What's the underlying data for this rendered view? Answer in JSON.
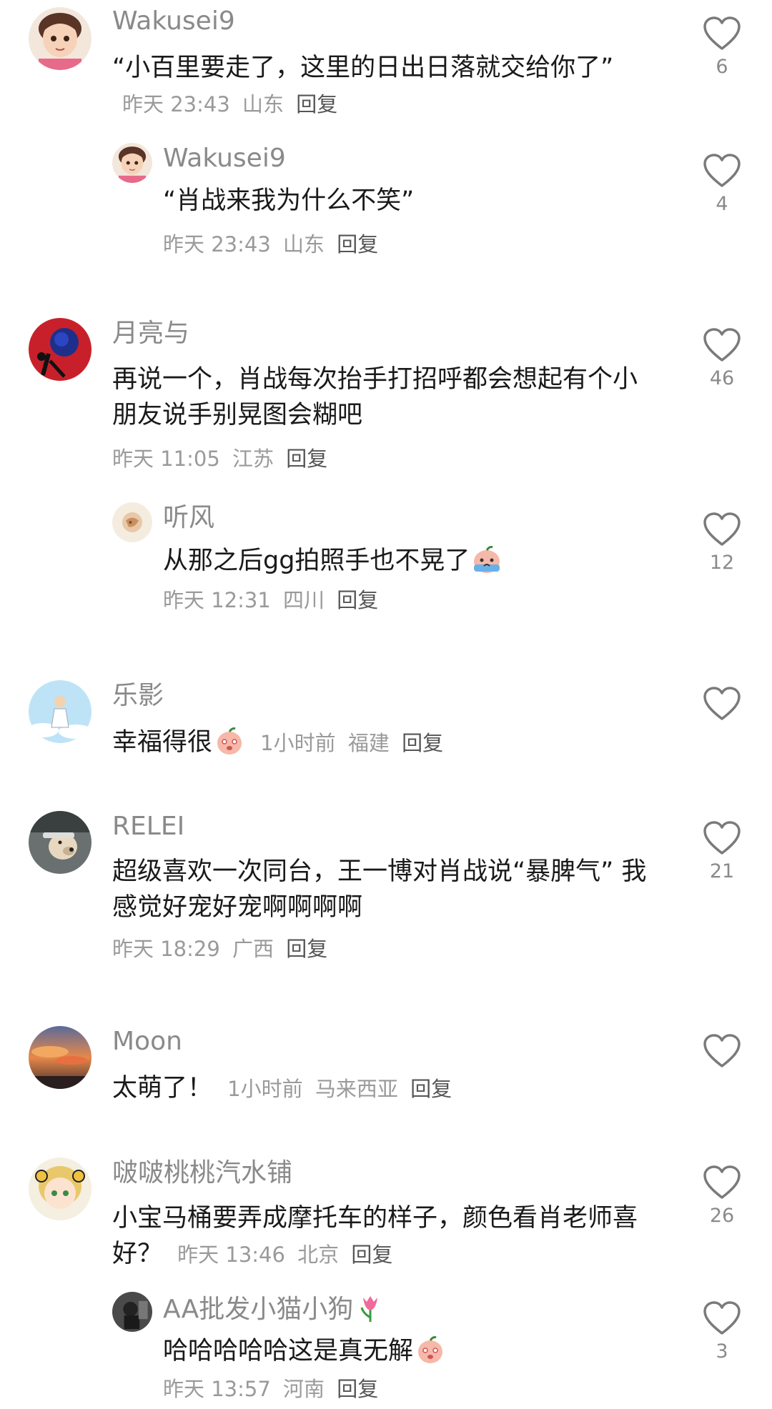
{
  "comments": [
    {
      "user": "Wakusei9",
      "text": "“小百里要走了，这里的日出日落就交给你了”",
      "time": "昨天 23:43",
      "location": "山东",
      "reply": "回复",
      "likes": "6",
      "avatar_icon": "cartoon-man-avatar",
      "replies": [
        {
          "user": "Wakusei9",
          "text": "“肖战来我为什么不笑”",
          "time": "昨天 23:43",
          "location": "山东",
          "reply": "回复",
          "likes": "4",
          "avatar_icon": "cartoon-man-avatar"
        }
      ]
    },
    {
      "user": "月亮与",
      "text": "再说一个，肖战每次抬手打招呼都会想起有个小朋友说手别晃图会糊吧",
      "time": "昨天 11:05",
      "location": "江苏",
      "reply": "回复",
      "likes": "46",
      "avatar_icon": "blue-rose-avatar",
      "replies": [
        {
          "user": "听风",
          "text": "从那之后gg拍照手也不晃了",
          "emoji": "crying-peach-emoji",
          "time": "昨天 12:31",
          "location": "四川",
          "reply": "回复",
          "likes": "12",
          "avatar_icon": "illustration-avatar"
        }
      ]
    },
    {
      "user": "乐影",
      "text": "幸福得很",
      "emoji": "peach-emoji",
      "time": "1小时前",
      "location": "福建",
      "reply": "回复",
      "likes": "",
      "avatar_icon": "sky-figure-avatar"
    },
    {
      "user": "RELEI",
      "text": "超级喜欢一次同台，王一博对肖战说“暴脾气” 我感觉好宠好宠啊啊啊啊",
      "time": "昨天 18:29",
      "location": "广西",
      "reply": "回复",
      "likes": "21",
      "avatar_icon": "dog-avatar"
    },
    {
      "user": "Moon",
      "text": "太萌了！",
      "time": "1小时前",
      "location": "马来西亚",
      "reply": "回复",
      "likes": "",
      "avatar_icon": "sunset-avatar"
    },
    {
      "user": "啵啵桃桃汽水铺",
      "text": "小宝马桶要弄成摩托车的样子，颜色看肖老师喜好？",
      "time": "昨天 13:46",
      "location": "北京",
      "reply": "回复",
      "likes": "26",
      "avatar_icon": "anime-girl-avatar",
      "replies": [
        {
          "user": "AA批发小猫小狗",
          "user_emoji": "tulip-emoji",
          "text": "哈哈哈哈哈这是真无解",
          "emoji": "peach-emoji",
          "time": "昨天 13:57",
          "location": "河南",
          "reply": "回复",
          "likes": "3",
          "avatar_icon": "dark-photo-avatar"
        }
      ]
    }
  ],
  "colors": {
    "username": "#8a8a8a",
    "text": "#1a1a1a",
    "meta": "#9a9a9a",
    "icon": "#7a7a7a"
  }
}
